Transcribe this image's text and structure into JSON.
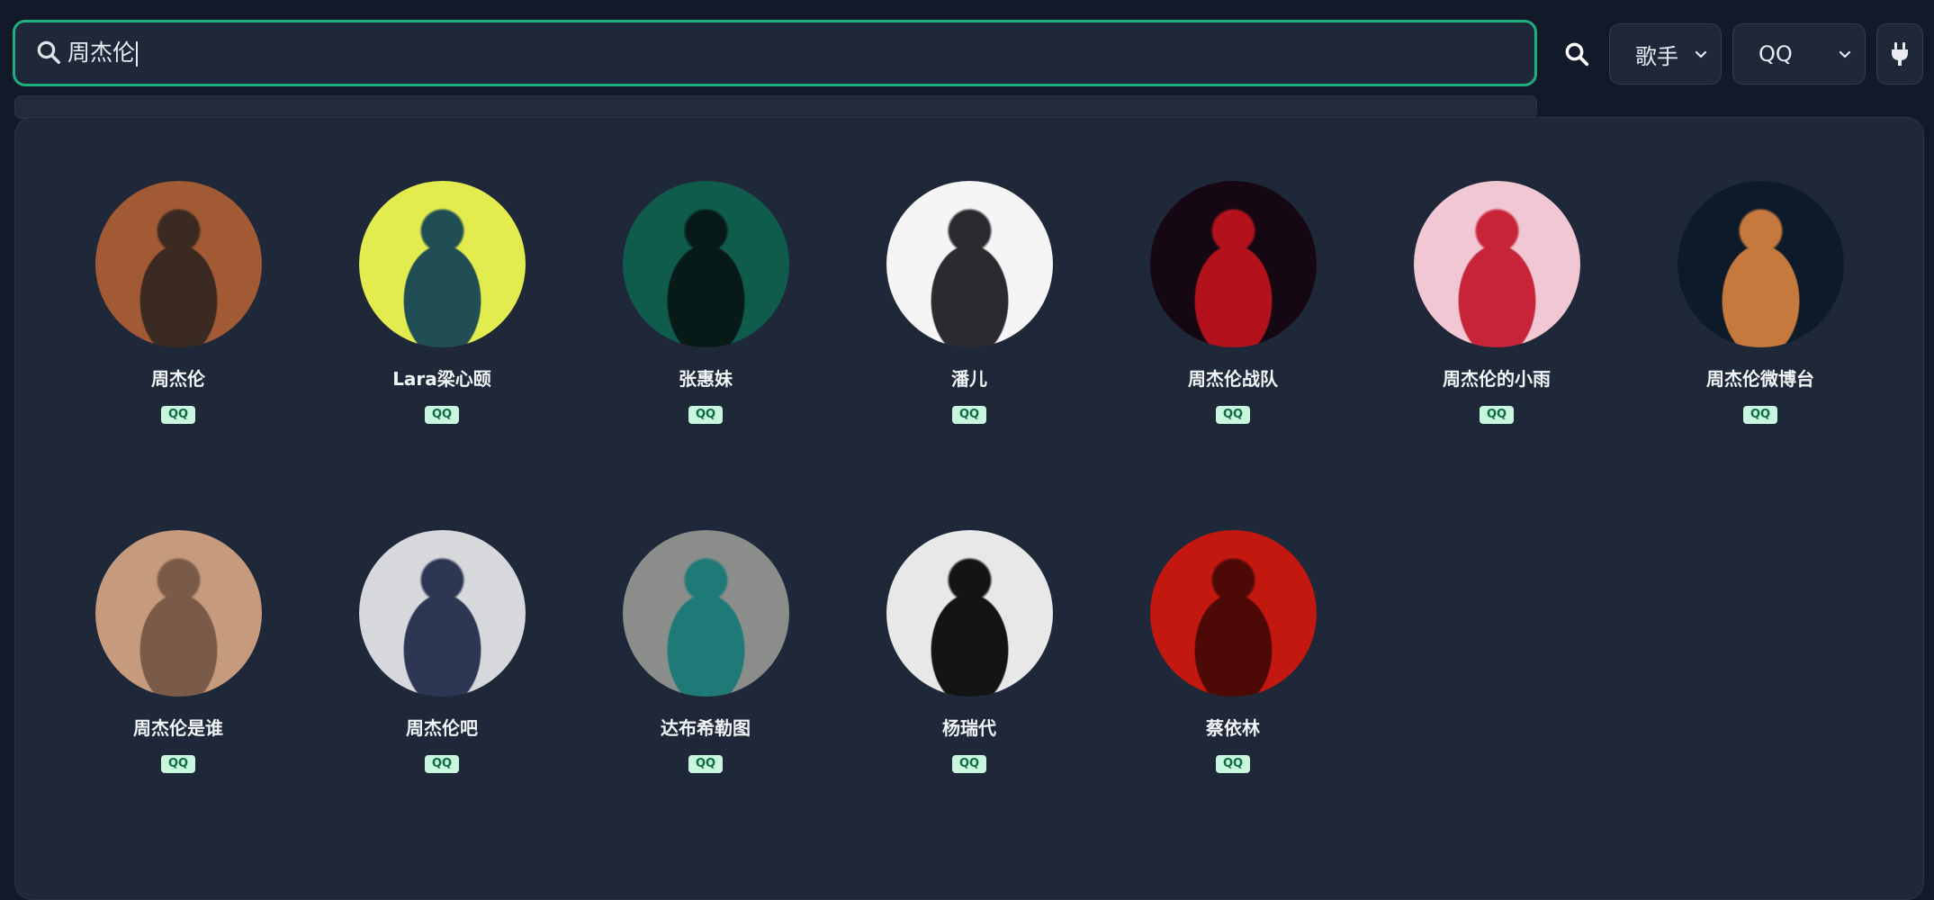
{
  "search": {
    "query": "周杰伦"
  },
  "type_select": {
    "value": "歌手"
  },
  "source_select": {
    "value": "QQ"
  },
  "artists": [
    {
      "name": "周杰伦",
      "source": "QQ",
      "bg": "#a15a34",
      "fg": "#3b2a22"
    },
    {
      "name": "Lara梁心颐",
      "source": "QQ",
      "bg": "#e2ec4e",
      "fg": "#204e54"
    },
    {
      "name": "张惠妹",
      "source": "QQ",
      "bg": "#0f5b4c",
      "fg": "#071a17"
    },
    {
      "name": "潘儿",
      "source": "QQ",
      "bg": "#f5f5f5",
      "fg": "#2a2a30"
    },
    {
      "name": "周杰伦战队",
      "source": "QQ",
      "bg": "#150812",
      "fg": "#b3121d"
    },
    {
      "name": "周杰伦的小雨",
      "source": "QQ",
      "bg": "#f0c7d3",
      "fg": "#c7243a"
    },
    {
      "name": "周杰伦微博台",
      "source": "QQ",
      "bg": "#0d1a29",
      "fg": "#c6793d"
    },
    {
      "name": "周杰伦是谁",
      "source": "QQ",
      "bg": "#c69a7c",
      "fg": "#7a5a48"
    },
    {
      "name": "周杰伦吧",
      "source": "QQ",
      "bg": "#d6d8dc",
      "fg": "#2d3652"
    },
    {
      "name": "达布希勒图",
      "source": "QQ",
      "bg": "#8a8d89",
      "fg": "#1f7a77"
    },
    {
      "name": "杨瑞代",
      "source": "QQ",
      "bg": "#e8e8e8",
      "fg": "#141414"
    },
    {
      "name": "蔡依林",
      "source": "QQ",
      "bg": "#c3180f",
      "fg": "#4d0906"
    }
  ]
}
